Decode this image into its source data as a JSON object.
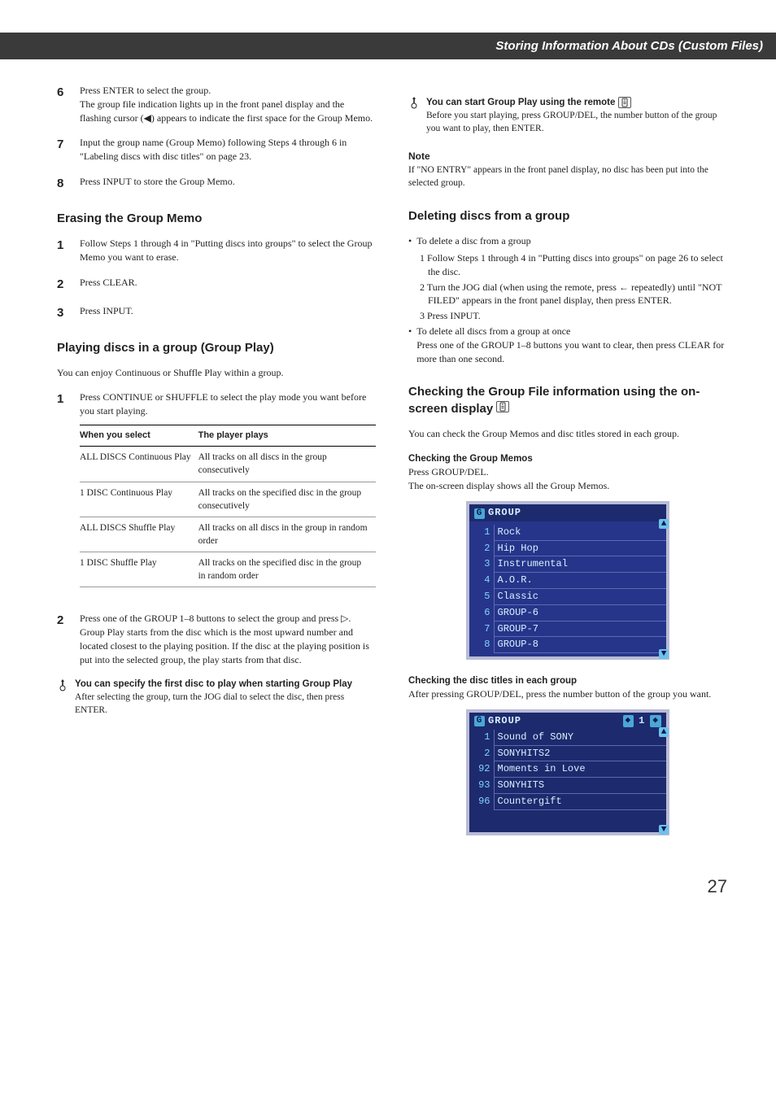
{
  "header_band": "Storing Information About CDs (Custom Files)",
  "left": {
    "steps_top": [
      {
        "n": "6",
        "text": "Press ENTER to select the group.\nThe group file indication lights up in the front panel display and the flashing cursor (◀) appears to indicate the first space for the Group Memo."
      },
      {
        "n": "7",
        "text": "Input the group name (Group Memo) following Steps 4 through 6 in \"Labeling discs with disc titles\" on page 23."
      },
      {
        "n": "8",
        "text": "Press INPUT to store the Group Memo."
      }
    ],
    "erase_heading": "Erasing the Group Memo",
    "erase_steps": [
      {
        "n": "1",
        "text": "Follow Steps 1 through 4 in \"Putting discs into groups\" to select the Group Memo you want to erase."
      },
      {
        "n": "2",
        "text": "Press CLEAR."
      },
      {
        "n": "3",
        "text": "Press INPUT."
      }
    ],
    "groupplay_heading": "Playing discs in a group (Group Play)",
    "groupplay_intro": "You can enjoy Continuous or Shuffle Play within a group.",
    "gp_step1_pre": "Press CONTINUE or SHUFFLE to select the play mode you want before you start playing.",
    "table": {
      "col1": "When you select",
      "col2": "The player plays",
      "rows": [
        [
          "ALL DISCS Continuous Play",
          "All tracks on all discs in the group consecutively"
        ],
        [
          "1 DISC Continuous Play",
          "All tracks on the specified disc in the group consecutively"
        ],
        [
          "ALL DISCS Shuffle Play",
          "All tracks on all discs in the group in random order"
        ],
        [
          "1 DISC Shuffle Play",
          "All tracks on the specified disc in the group in random order"
        ]
      ]
    },
    "gp_step2": "Press one of the GROUP 1–8 buttons to select the group and press ▷.\nGroup Play starts from the disc which is the most upward number and located closest to the playing position. If the disc at the playing position is put into the selected group, the play starts from that disc.",
    "tip1_title": "You can specify the first disc to play when starting Group Play",
    "tip1_text": "After selecting the group, turn the JOG dial to select the disc, then press ENTER."
  },
  "right": {
    "tip2_title": "You can start Group Play using the remote",
    "tip2_text": "Before you start playing, press GROUP/DEL, the number button of the group you want to play, then ENTER.",
    "note_heading": "Note",
    "note_text": "If \"NO ENTRY\" appears in the front panel display, no disc has been put into the selected group.",
    "delete_heading": "Deleting discs from a group",
    "delete_bullets": [
      {
        "lead": "To delete a disc from a group",
        "subs": [
          "1  Follow Steps 1 through 4 in \"Putting discs into groups\" on page 26 to select the disc.",
          "2  Turn the JOG dial (when using the remote, press ← repeatedly) until \"NOT FILED\" appears in the front panel display, then press ENTER.",
          "3  Press INPUT."
        ]
      },
      {
        "lead": "To delete all discs from a group at once\nPress one of the GROUP 1–8 buttons you want to clear, then press CLEAR for more than one second.",
        "subs": []
      }
    ],
    "check_heading": "Checking the Group File information using the on-screen display",
    "check_intro": "You can check the Group Memos and disc titles stored in each group.",
    "check_memos_sub": "Checking the Group Memos",
    "check_memos_text": "Press GROUP/DEL.\nThe on-screen display shows all the Group Memos.",
    "screen1": {
      "title": "GROUP",
      "rows": [
        {
          "i": "1",
          "t": "Rock"
        },
        {
          "i": "2",
          "t": "Hip Hop"
        },
        {
          "i": "3",
          "t": " Instrumental"
        },
        {
          "i": "4",
          "t": "A.O.R."
        },
        {
          "i": "5",
          "t": "Classic"
        },
        {
          "i": "6",
          "t": " GROUP-6"
        },
        {
          "i": "7",
          "t": " GROUP-7"
        },
        {
          "i": "8",
          "t": " GROUP-8"
        }
      ]
    },
    "check_titles_sub": "Checking the disc titles in each group",
    "check_titles_text": "After pressing GROUP/DEL, press the number button of the group you want.",
    "screen2": {
      "title": "GROUP",
      "page": "1",
      "rows": [
        {
          "i": "1",
          "t": "Sound of SONY"
        },
        {
          "i": "2",
          "t": "SONYHITS2"
        },
        {
          "i": "92",
          "t": "Moments in Love"
        },
        {
          "i": "93",
          "t": "SONYHITS"
        },
        {
          "i": "96",
          "t": "Countergift"
        }
      ]
    }
  },
  "page_number": "27"
}
